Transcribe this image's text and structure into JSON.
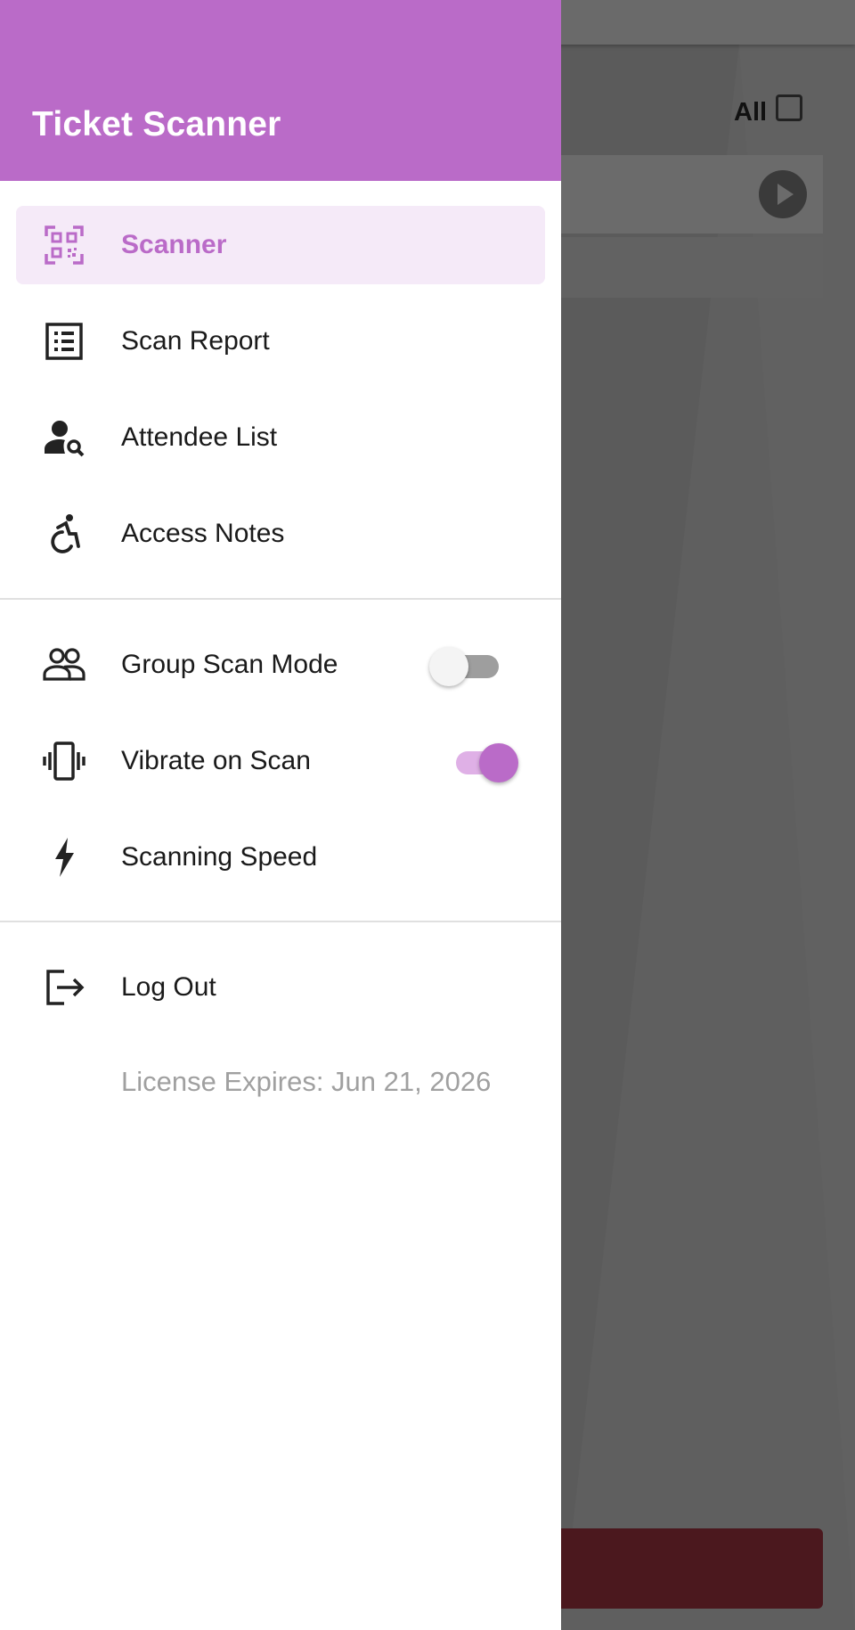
{
  "background": {
    "filter_all_label": "All"
  },
  "drawer": {
    "title": "Ticket Scanner",
    "header_color": "#ba6bc8",
    "accent_color": "#ba6bc8",
    "nav_items": [
      {
        "label": "Scanner",
        "icon": "qr-code-scanner-icon",
        "active": true
      },
      {
        "label": "Scan Report",
        "icon": "list-report-icon",
        "active": false
      },
      {
        "label": "Attendee List",
        "icon": "person-search-icon",
        "active": false
      },
      {
        "label": "Access Notes",
        "icon": "accessibility-icon",
        "active": false
      }
    ],
    "settings": [
      {
        "label": "Group Scan Mode",
        "icon": "group-icon",
        "toggle": false
      },
      {
        "label": "Vibrate on Scan",
        "icon": "vibration-icon",
        "toggle": true
      },
      {
        "label": "Scanning Speed",
        "icon": "bolt-icon"
      }
    ],
    "logout": {
      "label": "Log Out",
      "icon": "logout-icon"
    },
    "license_text": "License Expires: Jun 21, 2026"
  }
}
